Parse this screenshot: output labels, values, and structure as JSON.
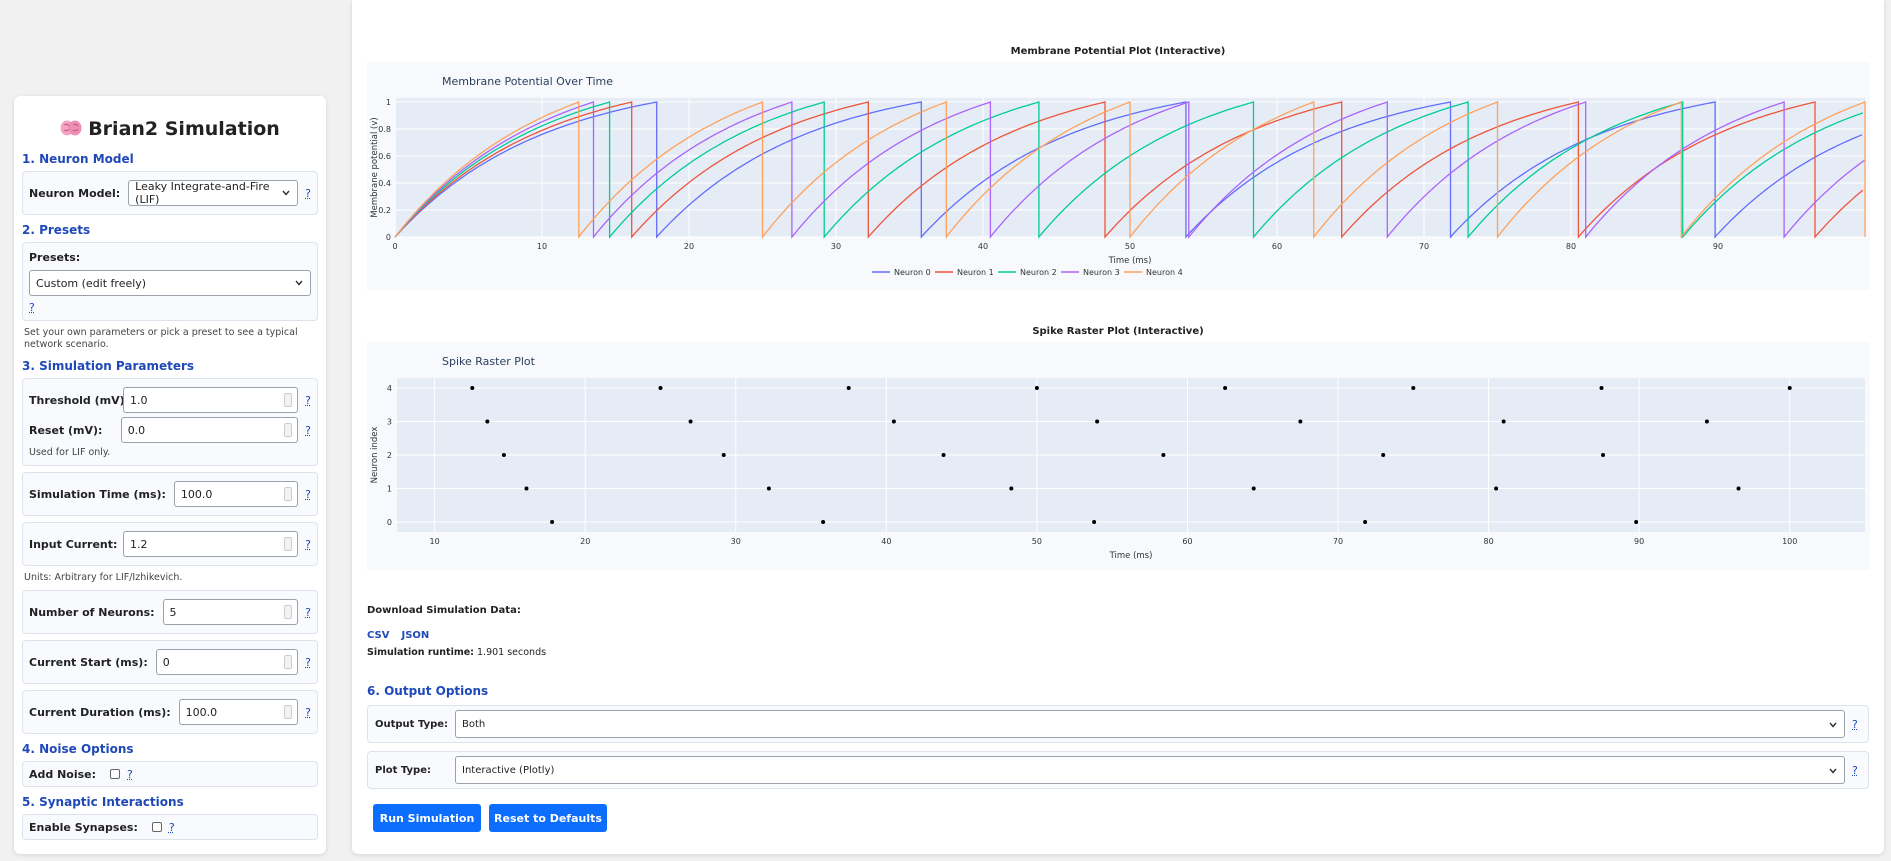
{
  "sidebar": {
    "title": "Brian2 Simulation",
    "neuron_model": {
      "heading": "1. Neuron Model",
      "label": "Neuron Model:",
      "value": "Leaky Integrate-and-Fire (LIF)",
      "help": "?"
    },
    "presets": {
      "heading": "2. Presets",
      "label": "Presets:",
      "value": "Custom (edit freely)",
      "help": "?",
      "note": "Set your own parameters or pick a preset to see a typical network scenario."
    },
    "sim_params": {
      "heading": "3. Simulation Parameters",
      "threshold_label": "Threshold (mV):",
      "threshold_value": "1.0",
      "reset_label": "Reset (mV):",
      "reset_value": "0.0",
      "reset_note": "Used for LIF only.",
      "sim_time_label": "Simulation Time (ms):",
      "sim_time_value": "100.0",
      "input_current_label": "Input Current:",
      "input_current_value": "1.2",
      "units_note": "Units: Arbitrary for LIF/Izhikevich.",
      "num_neurons_label": "Number of Neurons:",
      "num_neurons_value": "5",
      "current_start_label": "Current Start (ms):",
      "current_start_value": "0",
      "current_duration_label": "Current Duration (ms):",
      "current_duration_value": "100.0",
      "help": "?"
    },
    "noise": {
      "heading": "4. Noise Options",
      "label": "Add Noise:",
      "checked": false,
      "help": "?"
    },
    "synapses": {
      "heading": "5. Synaptic Interactions",
      "label": "Enable Synapses:",
      "checked": false,
      "help": "?"
    }
  },
  "main": {
    "membrane_plot_heading": "Membrane Potential Plot (Interactive)",
    "raster_plot_heading": "Spike Raster Plot (Interactive)",
    "downloads_heading": "Download Simulation Data:",
    "download_csv": "CSV",
    "download_json": "JSON",
    "runtime_label": "Simulation runtime:",
    "runtime_value": "1.901 seconds",
    "output_options_heading": "6. Output Options",
    "output_type_label": "Output Type:",
    "output_type_value": "Both",
    "plot_type_label": "Plot Type:",
    "plot_type_value": "Interactive (Plotly)",
    "help": "?",
    "run_button": "Run Simulation",
    "reset_button": "Reset to Defaults"
  },
  "chart_data": [
    {
      "type": "line",
      "title": "Membrane Potential Over Time",
      "xlabel": "Time (ms)",
      "ylabel": "Membrane potential (v)",
      "xlim": [
        0,
        100
      ],
      "ylim": [
        0,
        1.03
      ],
      "xticks": [
        0,
        10,
        20,
        30,
        40,
        50,
        60,
        70,
        80,
        90
      ],
      "yticks": [
        0,
        0.2,
        0.4,
        0.6,
        0.8,
        1
      ],
      "grid": true,
      "legend_position": "bottom-center",
      "series": [
        {
          "name": "Neuron 0",
          "color": "#636efa",
          "spikes": [
            17.8,
            35.8,
            53.8,
            71.8,
            89.8
          ]
        },
        {
          "name": "Neuron 1",
          "color": "#ef553b",
          "spikes": [
            16.1,
            32.2,
            48.3,
            64.4,
            80.5,
            96.6
          ]
        },
        {
          "name": "Neuron 2",
          "color": "#00cc96",
          "spikes": [
            14.6,
            29.2,
            43.8,
            58.4,
            73.0,
            87.6
          ]
        },
        {
          "name": "Neuron 3",
          "color": "#ab63fa",
          "spikes": [
            13.5,
            27.0,
            40.5,
            54.0,
            67.5,
            81.0,
            94.5
          ]
        },
        {
          "name": "Neuron 4",
          "color": "#ffa15a",
          "spikes": [
            12.5,
            25.0,
            37.5,
            50.0,
            62.5,
            75.0,
            87.5,
            100.0
          ]
        }
      ]
    },
    {
      "type": "scatter",
      "title": "Spike Raster Plot",
      "xlabel": "Time (ms)",
      "ylabel": "Neuron index",
      "xlim": [
        7.5,
        105
      ],
      "ylim": [
        -0.3,
        4.3
      ],
      "xticks": [
        10,
        20,
        30,
        40,
        50,
        60,
        70,
        80,
        90,
        100
      ],
      "yticks": [
        0,
        1,
        2,
        3,
        4
      ],
      "grid": true,
      "points": [
        [
          12.5,
          4
        ],
        [
          25.0,
          4
        ],
        [
          37.5,
          4
        ],
        [
          50.0,
          4
        ],
        [
          62.5,
          4
        ],
        [
          75.0,
          4
        ],
        [
          87.5,
          4
        ],
        [
          100.0,
          4
        ],
        [
          13.5,
          3
        ],
        [
          27.0,
          3
        ],
        [
          40.5,
          3
        ],
        [
          54.0,
          3
        ],
        [
          67.5,
          3
        ],
        [
          81.0,
          3
        ],
        [
          94.5,
          3
        ],
        [
          14.6,
          2
        ],
        [
          29.2,
          2
        ],
        [
          43.8,
          2
        ],
        [
          58.4,
          2
        ],
        [
          73.0,
          2
        ],
        [
          87.6,
          2
        ],
        [
          16.1,
          1
        ],
        [
          32.2,
          1
        ],
        [
          48.3,
          1
        ],
        [
          64.4,
          1
        ],
        [
          80.5,
          1
        ],
        [
          96.6,
          1
        ],
        [
          17.8,
          0
        ],
        [
          35.8,
          0
        ],
        [
          53.8,
          0
        ],
        [
          71.8,
          0
        ],
        [
          89.8,
          0
        ]
      ]
    }
  ]
}
